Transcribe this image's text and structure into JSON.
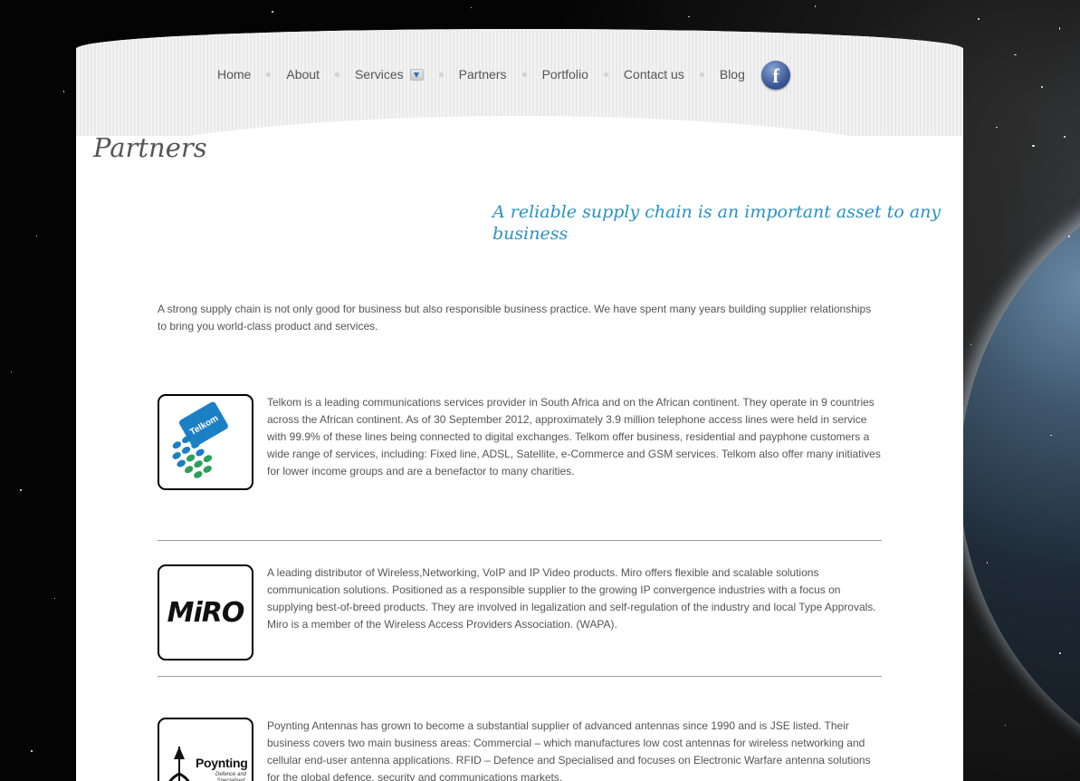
{
  "nav": {
    "items": [
      "Home",
      "About",
      "Services",
      "Partners",
      "Portfolio",
      "Contact us",
      "Blog"
    ]
  },
  "social": {
    "facebook_glyph": "f"
  },
  "page": {
    "title": "Partners",
    "tagline": "A reliable supply chain is an important asset to any business",
    "intro": "A strong supply chain is not only good for business but also responsible business practice. We have spent many years building supplier relationships to bring you world-class product and services."
  },
  "partners": [
    {
      "logo_text": "Telkom",
      "description": "Telkom is a leading communications services provider in South Africa and on the African continent. They operate in 9 countries across the African continent. As of 30 September 2012, approximately 3.9 million telephone access lines were held in service with 99.9% of these lines being connected to digital exchanges. Telkom offer business, residential and payphone customers a wide range of services, including: Fixed line, ADSL, Satellite, e-Commerce and GSM services. Telkom also offer many initiatives for lower income groups and are a benefactor to many charities."
    },
    {
      "logo_text": "MiRO",
      "description": "A leading distributor of Wireless,Networking, VoIP and IP Video products. Miro offers flexible and scalable solutions communication solutions. Positioned as a responsible supplier to the growing IP convergence industries with a focus on supplying best-of-breed products. They are involved in legalization and self-regulation of the industry and local Type Approvals. Miro is a member of the Wireless Access Providers Association. (WAPA)."
    },
    {
      "logo_text": "Poynting",
      "logo_subtext": "Defence and Specialised",
      "description": "Poynting Antennas has grown to become a substantial supplier of advanced antennas since 1990 and is JSE listed. Their business covers two main business areas: Commercial – which manufactures low cost antennas for wireless networking and cellular end-user antenna applications. RFID – Defence and Specialised and focuses on Electronic Warfare antenna solutions for the global defence, security and communications markets."
    }
  ],
  "colors": {
    "tagline": "#2a91c2",
    "body_text": "#555555",
    "facebook": "#3b5998",
    "telkom_blue": "#1b7fc4",
    "telkom_green": "#2aa05a"
  }
}
